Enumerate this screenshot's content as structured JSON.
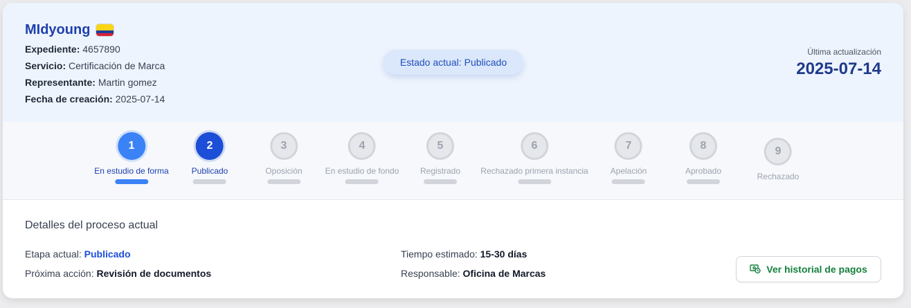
{
  "header": {
    "brand_name": "MIdyoung",
    "flag_icon": "colombia-flag-icon",
    "fields": [
      {
        "label": "Expediente:",
        "value": "4657890"
      },
      {
        "label": "Servicio:",
        "value": "Certificación de Marca"
      },
      {
        "label": "Representante:",
        "value": "Martin gomez"
      },
      {
        "label": "Fecha de creación:",
        "value": "2025-07-14"
      }
    ],
    "status_label": "Estado actual:",
    "status_value": "Publicado",
    "update_label": "Última actualización",
    "update_date": "2025-07-14"
  },
  "steps": [
    {
      "number": "1",
      "label": "En estudio de forma",
      "state": "completed"
    },
    {
      "number": "2",
      "label": "Publicado",
      "state": "current"
    },
    {
      "number": "3",
      "label": "Oposición",
      "state": "pending"
    },
    {
      "number": "4",
      "label": "En estudio de fondo",
      "state": "pending"
    },
    {
      "number": "5",
      "label": "Registrado",
      "state": "pending"
    },
    {
      "number": "6",
      "label": "Rechazado primera instancia",
      "state": "pending"
    },
    {
      "number": "7",
      "label": "Apelación",
      "state": "pending"
    },
    {
      "number": "8",
      "label": "Aprobado",
      "state": "pending"
    },
    {
      "number": "9",
      "label": "Rechazado",
      "state": "pending"
    }
  ],
  "details": {
    "title": "Detalles del proceso actual",
    "etapa_label": "Etapa actual:",
    "etapa_value": "Publicado",
    "proxima_label": "Próxima acción:",
    "proxima_value": "Revisión de documentos",
    "tiempo_label": "Tiempo estimado:",
    "tiempo_value": "15-30 días",
    "responsable_label": "Responsable:",
    "responsable_value": "Oficina de Marcas",
    "payments_button": "Ver historial de pagos",
    "payments_icon": "money-history-icon"
  },
  "colors": {
    "primary": "#1e40af",
    "step_active": "#3b82f6",
    "step_current": "#1d4ed8",
    "header_bg": "#eef4fd",
    "button_text": "#15803d"
  }
}
